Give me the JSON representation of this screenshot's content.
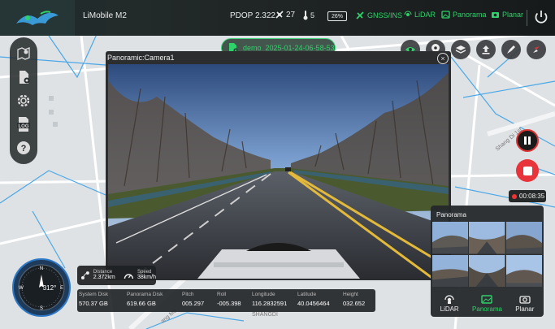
{
  "app": {
    "title": "LiMobile M2"
  },
  "status": {
    "pdop": "PDOP 2.322",
    "satellites": "27",
    "temperature": "5",
    "battery": "26%",
    "modules": [
      {
        "label": "GNSS/INS",
        "icon": "satellite-icon"
      },
      {
        "label": "LiDAR",
        "icon": "lidar-icon"
      },
      {
        "label": "Panorama",
        "icon": "panorama-icon"
      },
      {
        "label": "Planar",
        "icon": "camera-icon"
      }
    ],
    "accent_color": "#2fd26a"
  },
  "sidebar": {
    "items": [
      {
        "name": "map-layers",
        "icon": "map-pin-icon"
      },
      {
        "name": "file-settings",
        "icon": "file-gear-icon"
      },
      {
        "name": "settings",
        "icon": "gear-icon"
      },
      {
        "name": "log",
        "icon": "log-icon",
        "label": "LOG"
      },
      {
        "name": "help",
        "icon": "help-icon",
        "label": "?"
      }
    ]
  },
  "project": {
    "file_name": "demo_2025-01-24-06-58-53"
  },
  "right_tools": [
    "eye-icon",
    "location-pin-icon",
    "layers-icon",
    "upload-icon",
    "broom-icon",
    "compass-needle-icon"
  ],
  "camera": {
    "title": "Panoramic:Camera1",
    "close_label": "×"
  },
  "recording": {
    "timer": "00:08:35",
    "color": "#e9333a"
  },
  "panorama_panel": {
    "title": "Panorama",
    "tabs": [
      {
        "label": "LiDAR",
        "icon": "lidar-icon",
        "active": false
      },
      {
        "label": "Panorama",
        "icon": "panorama-icon",
        "active": true
      },
      {
        "label": "Planar",
        "icon": "camera-icon",
        "active": false
      }
    ]
  },
  "compass": {
    "heading": "312°"
  },
  "motion": {
    "distance_label": "Distance",
    "distance_value": "2.372km",
    "speed_label": "Speed",
    "speed_value": "38km/h"
  },
  "info": [
    {
      "label": "System Disk",
      "value": "570.37 GB"
    },
    {
      "label": "Panorama Disk",
      "value": "619.66 GB"
    },
    {
      "label": "Pitch",
      "value": "005.297"
    },
    {
      "label": "Roll",
      "value": "-005.398"
    },
    {
      "label": "Longitude",
      "value": "116.2832591"
    },
    {
      "label": "Latitude",
      "value": "40.0456464"
    },
    {
      "label": "Height",
      "value": "032.652"
    }
  ],
  "map_labels": {
    "shangdi": "SHANGDI",
    "road_bottom": "ang Mo",
    "road_right": "Shang Di 1st"
  }
}
